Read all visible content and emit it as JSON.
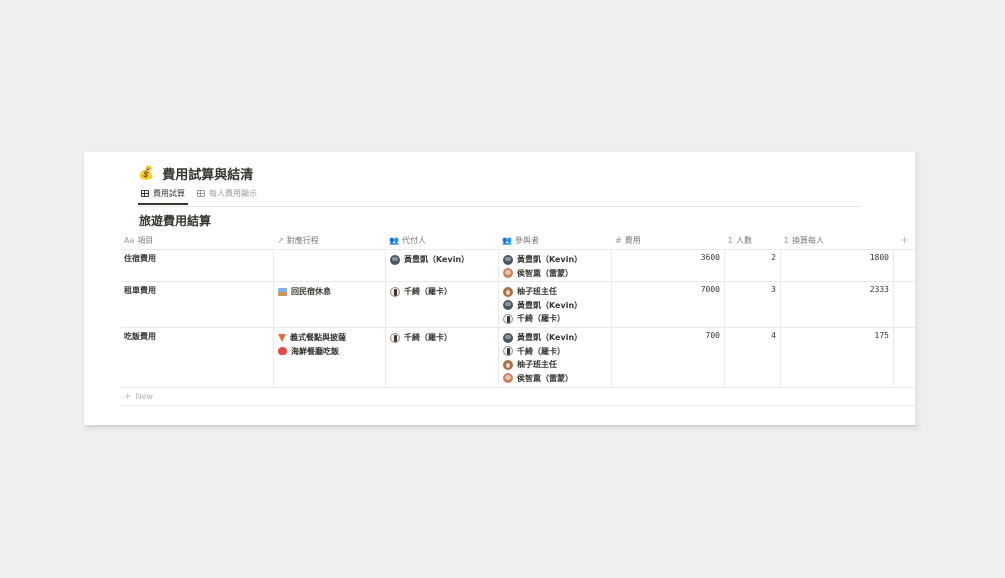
{
  "page": {
    "emoji": "💰",
    "title": "費用試算與結清"
  },
  "tabs": [
    {
      "label": "費用試算",
      "active": true
    },
    {
      "label": "每人費用顯示",
      "active": false
    }
  ],
  "database": {
    "title": "旅遊費用結算",
    "columns": [
      {
        "icon": "Aa",
        "label": "項目"
      },
      {
        "icon": "↗",
        "label": "對應行程"
      },
      {
        "icon": "👥",
        "label": "代付人"
      },
      {
        "icon": "👥",
        "label": "參與者"
      },
      {
        "icon": "#",
        "label": "費用"
      },
      {
        "icon": "Σ",
        "label": "人數"
      },
      {
        "icon": "Σ",
        "label": "換算每人"
      }
    ],
    "add_column": "+",
    "rows": [
      {
        "item": "住宿費用",
        "relations": [],
        "payer": [
          {
            "name": "黃豊凱（Kevin）",
            "avatar": "kevin"
          }
        ],
        "participants": [
          {
            "name": "黃豊凱（Kevin）",
            "avatar": "kevin"
          },
          {
            "name": "侯智熏（雷蒙）",
            "avatar": "hou"
          }
        ],
        "cost": "3600",
        "people": "2",
        "per_person": "1800"
      },
      {
        "item": "租車費用",
        "relations": [
          {
            "name": "回民宿休息",
            "icon": "hotspring"
          }
        ],
        "payer": [
          {
            "name": "千綺（羅卡）",
            "avatar": "qian"
          }
        ],
        "participants": [
          {
            "name": "柚子班主任",
            "avatar": "you"
          },
          {
            "name": "黃豊凱（Kevin）",
            "avatar": "kevin"
          },
          {
            "name": "千綺（羅卡）",
            "avatar": "qian"
          }
        ],
        "cost": "7000",
        "people": "3",
        "per_person": "2333"
      },
      {
        "item": "吃飯費用",
        "relations": [
          {
            "name": "義式餐點與披薩",
            "icon": "pizza"
          },
          {
            "name": "海鮮餐廳吃飯",
            "icon": "crab"
          }
        ],
        "payer": [
          {
            "name": "千綺（羅卡）",
            "avatar": "qian"
          }
        ],
        "participants": [
          {
            "name": "黃豊凱（Kevin）",
            "avatar": "kevin"
          },
          {
            "name": "千綺（羅卡）",
            "avatar": "qian"
          },
          {
            "name": "柚子班主任",
            "avatar": "you"
          },
          {
            "name": "侯智熏（雷蒙）",
            "avatar": "hou"
          }
        ],
        "cost": "700",
        "people": "4",
        "per_person": "175"
      }
    ],
    "new_label": "New"
  }
}
